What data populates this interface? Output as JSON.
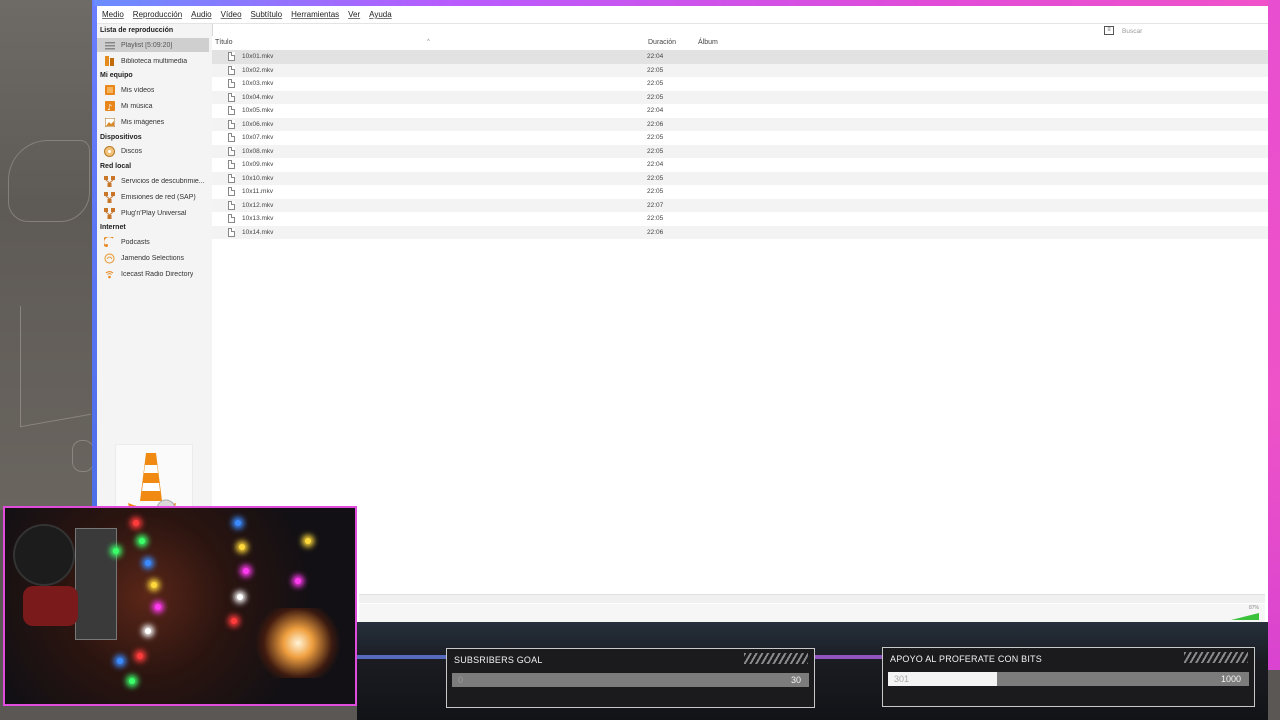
{
  "menu": [
    "Medio",
    "Reproducción",
    "Audio",
    "Vídeo",
    "Subtítulo",
    "Herramientas",
    "Ver",
    "Ayuda"
  ],
  "search": {
    "placeholder": "Buscar"
  },
  "sidebar": {
    "playlist_header": "Lista de reproducción",
    "playlist": {
      "label": "Playlist [5:09:20]",
      "icon": "playlist-icon"
    },
    "media_library": {
      "label": "Biblioteca multimedia",
      "icon": "library-icon"
    },
    "my_computer_header": "Mi equipo",
    "my_videos": {
      "label": "Mis vídeos",
      "icon": "video-folder-icon"
    },
    "my_music": {
      "label": "Mi música",
      "icon": "music-icon"
    },
    "my_images": {
      "label": "Mis imágenes",
      "icon": "image-icon"
    },
    "devices_header": "Dispositivos",
    "discs": {
      "label": "Discos",
      "icon": "disc-icon"
    },
    "local_network_header": "Red local",
    "discovery": {
      "label": "Servicios de descubrimie...",
      "icon": "network-icon"
    },
    "sap": {
      "label": "Emisiones de red (SAP)",
      "icon": "network-icon"
    },
    "upnp": {
      "label": "Plug'n'Play Universal",
      "icon": "network-icon"
    },
    "internet_header": "Internet",
    "podcasts": {
      "label": "Podcasts",
      "icon": "podcast-icon"
    },
    "jamendo": {
      "label": "Jamendo Selections",
      "icon": "jamendo-icon"
    },
    "icecast": {
      "label": "Icecast Radio Directory",
      "icon": "radio-icon"
    }
  },
  "columns": {
    "title": "Título",
    "duration": "Duración",
    "album": "Álbum"
  },
  "playlist_rows": [
    {
      "title": "10x01.mkv",
      "duration": "22:04"
    },
    {
      "title": "10x02.mkv",
      "duration": "22:05"
    },
    {
      "title": "10x03.mkv",
      "duration": "22:05"
    },
    {
      "title": "10x04.mkv",
      "duration": "22:05"
    },
    {
      "title": "10x05.mkv",
      "duration": "22:04"
    },
    {
      "title": "10x06.mkv",
      "duration": "22:06"
    },
    {
      "title": "10x07.mkv",
      "duration": "22:05"
    },
    {
      "title": "10x08.mkv",
      "duration": "22:05"
    },
    {
      "title": "10x09.mkv",
      "duration": "22:04"
    },
    {
      "title": "10x10.mkv",
      "duration": "22:05"
    },
    {
      "title": "10x11.mkv",
      "duration": "22:05"
    },
    {
      "title": "10x12.mkv",
      "duration": "22:07"
    },
    {
      "title": "10x13.mkv",
      "duration": "22:05"
    },
    {
      "title": "10x14.mkv",
      "duration": "22:06"
    }
  ],
  "status": {
    "volume": "87%"
  },
  "goals": {
    "subs": {
      "title": "SUBSRIBERS GOAL",
      "current": "0",
      "target": "30",
      "fraction": 0.0
    },
    "bits": {
      "title": "APOYO AL PROFERATE CON BITS",
      "current": "301",
      "target": "1000",
      "fraction": 0.301
    }
  },
  "colors": {
    "frame_accent": "#e04ddc",
    "selected_row": "#e2e2e2",
    "volume": "#3ac23a"
  }
}
